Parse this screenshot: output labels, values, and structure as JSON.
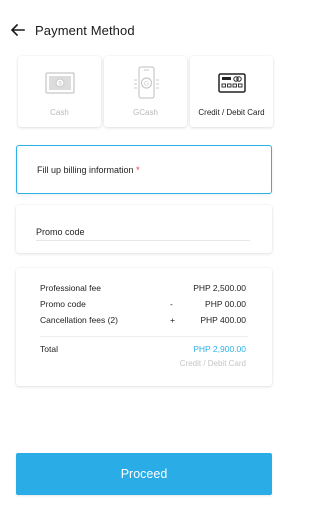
{
  "header": {
    "back_icon": "arrow-left-icon",
    "title": "Payment Method"
  },
  "payment_methods": [
    {
      "label": "Cash",
      "icon": "cash-icon",
      "selected": false
    },
    {
      "label": "GCash",
      "icon": "gcash-phone-icon",
      "selected": false
    },
    {
      "label": "Credit / Debit Card",
      "icon": "credit-card-icon",
      "selected": true
    }
  ],
  "billing": {
    "label": "Fill up billing information",
    "required_mark": "*"
  },
  "promo": {
    "placeholder": "Promo code",
    "value": ""
  },
  "summary": {
    "rows": [
      {
        "label": "Professional fee",
        "sign": "",
        "value": "PHP 2,500.00"
      },
      {
        "label": "Promo code",
        "sign": "-",
        "value": "PHP 00.00"
      },
      {
        "label": "Cancellation fees (2)",
        "sign": "+",
        "value": "PHP 400.00"
      }
    ],
    "total": {
      "label": "Total",
      "value": "PHP 2,900.00",
      "method": "Credit / Debit Card"
    }
  },
  "proceed_label": "Proceed",
  "colors": {
    "accent": "#2aace6",
    "required": "#e53935"
  }
}
